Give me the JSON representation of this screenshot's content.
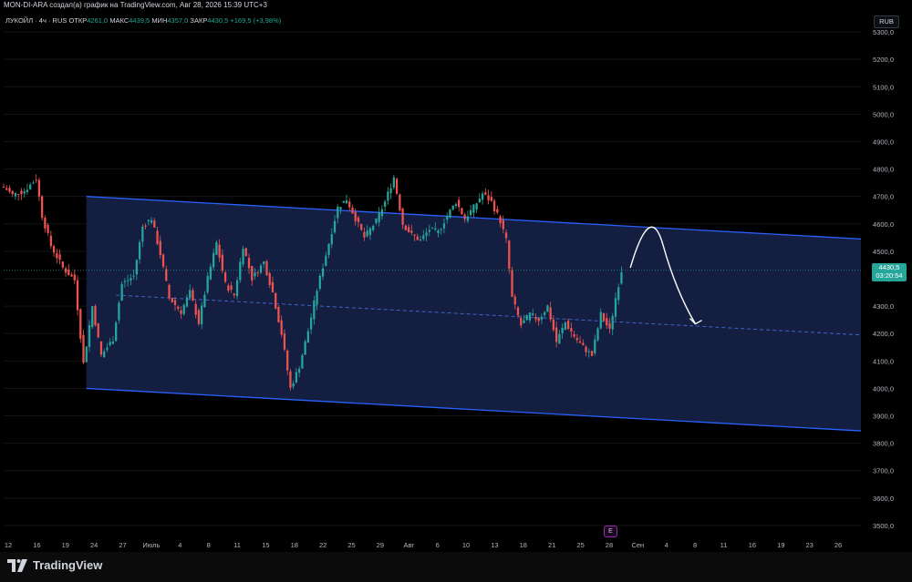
{
  "header": {
    "attribution": "MON-DI-ARA создал(а) график на TradingView.com, Авг 28, 2026 15:39 UTC+3"
  },
  "legend": {
    "symbol": "ЛУКОЙЛ · 4ч · RUS",
    "open_label": "ОТКР",
    "open_value": "4261,0",
    "high_label": "МАКС",
    "high_value": "4439,5",
    "low_label": "МИН",
    "low_value": "4357,0",
    "close_label": "ЗАКР",
    "close_value": "4430,5",
    "change": "+169,5 (+3,98%)"
  },
  "currency": "RUB",
  "price_tag": {
    "price": "4430,5",
    "timer": "03:20:54"
  },
  "event_badge": "E",
  "branding": {
    "logo_text": "TradingView",
    "logo_icon": "tradingview-logo-icon"
  },
  "colors": {
    "up": "#26a69a",
    "down": "#ef5350",
    "channel_line": "#2962ff",
    "channel_fill": "#152045",
    "midline": "#3f63c9",
    "background": "#000000",
    "arrow": "#ffffff"
  },
  "chart_data": {
    "type": "candlestick",
    "y_ticks": [
      3500,
      3600,
      3700,
      3800,
      3900,
      4000,
      4100,
      4200,
      4300,
      4400,
      4500,
      4600,
      4700,
      4800,
      4900,
      5000,
      5100,
      5200,
      5300
    ],
    "y_tick_labels": [
      "3500,0",
      "3600,0",
      "3700,0",
      "3800,0",
      "3900,0",
      "4000,0",
      "4100,0",
      "4200,0",
      "4300,0",
      "4400,0",
      "4500,0",
      "4600,0",
      "4700,0",
      "4800,0",
      "4900,0",
      "5000,0",
      "5100,0",
      "5200,0",
      "5300,0"
    ],
    "x_tick_labels": [
      "12",
      "16",
      "19",
      "24",
      "27",
      "Июль",
      "4",
      "8",
      "11",
      "15",
      "18",
      "22",
      "25",
      "29",
      "Авг",
      "6",
      "10",
      "13",
      "18",
      "21",
      "25",
      "28",
      "Сен",
      "4",
      "8",
      "11",
      "16",
      "19",
      "23",
      "26"
    ],
    "x_range_bars": [
      0,
      290
    ],
    "y_range": [
      3450,
      5350
    ],
    "last_bar": 209,
    "current_price": 4430.5,
    "channel": {
      "upper": {
        "start": [
          28,
          4700
        ],
        "end": [
          290,
          4545
        ]
      },
      "lower": {
        "start": [
          28,
          4000
        ],
        "end": [
          290,
          3845
        ]
      },
      "mid": {
        "start": [
          38,
          4340
        ],
        "end": [
          290,
          4195
        ]
      }
    },
    "projection": {
      "start": [
        212,
        4440
      ],
      "peak": [
        220,
        4555
      ],
      "end": [
        234,
        4235
      ]
    },
    "price_path": [
      [
        0,
        4735
      ],
      [
        3,
        4705
      ],
      [
        7,
        4720
      ],
      [
        11,
        4765
      ],
      [
        13,
        4630
      ],
      [
        16,
        4520
      ],
      [
        20,
        4440
      ],
      [
        24,
        4395
      ],
      [
        27,
        4090
      ],
      [
        30,
        4300
      ],
      [
        33,
        4120
      ],
      [
        37,
        4180
      ],
      [
        40,
        4380
      ],
      [
        44,
        4410
      ],
      [
        47,
        4590
      ],
      [
        50,
        4620
      ],
      [
        53,
        4490
      ],
      [
        56,
        4330
      ],
      [
        60,
        4280
      ],
      [
        63,
        4350
      ],
      [
        66,
        4240
      ],
      [
        69,
        4400
      ],
      [
        72,
        4530
      ],
      [
        75,
        4380
      ],
      [
        78,
        4340
      ],
      [
        81,
        4520
      ],
      [
        84,
        4400
      ],
      [
        88,
        4460
      ],
      [
        91,
        4350
      ],
      [
        94,
        4200
      ],
      [
        97,
        4000
      ],
      [
        100,
        4080
      ],
      [
        103,
        4210
      ],
      [
        106,
        4360
      ],
      [
        110,
        4530
      ],
      [
        113,
        4660
      ],
      [
        116,
        4690
      ],
      [
        119,
        4620
      ],
      [
        122,
        4550
      ],
      [
        126,
        4610
      ],
      [
        129,
        4680
      ],
      [
        132,
        4770
      ],
      [
        135,
        4600
      ],
      [
        138,
        4560
      ],
      [
        141,
        4540
      ],
      [
        144,
        4580
      ],
      [
        147,
        4570
      ],
      [
        150,
        4630
      ],
      [
        153,
        4680
      ],
      [
        156,
        4620
      ],
      [
        159,
        4660
      ],
      [
        162,
        4710
      ],
      [
        165,
        4680
      ],
      [
        168,
        4610
      ],
      [
        170,
        4540
      ],
      [
        172,
        4330
      ],
      [
        175,
        4230
      ],
      [
        178,
        4270
      ],
      [
        181,
        4250
      ],
      [
        184,
        4300
      ],
      [
        187,
        4170
      ],
      [
        190,
        4240
      ],
      [
        193,
        4190
      ],
      [
        196,
        4150
      ],
      [
        199,
        4120
      ],
      [
        202,
        4270
      ],
      [
        205,
        4210
      ],
      [
        207,
        4330
      ],
      [
        209,
        4430
      ]
    ]
  }
}
